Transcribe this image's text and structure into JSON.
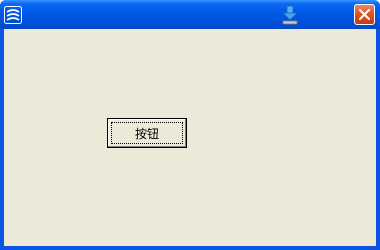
{
  "window": {
    "title": "",
    "app_icon": "app-logo-icon",
    "title_action_icon": "download-icon",
    "close_icon": "close-icon"
  },
  "content": {
    "button_label": "按钮"
  },
  "colors": {
    "titlebar": "#0a55e3",
    "client_background": "#ece9d8",
    "close_button": "#d8562e",
    "download_arrow": "#1e88e5"
  }
}
